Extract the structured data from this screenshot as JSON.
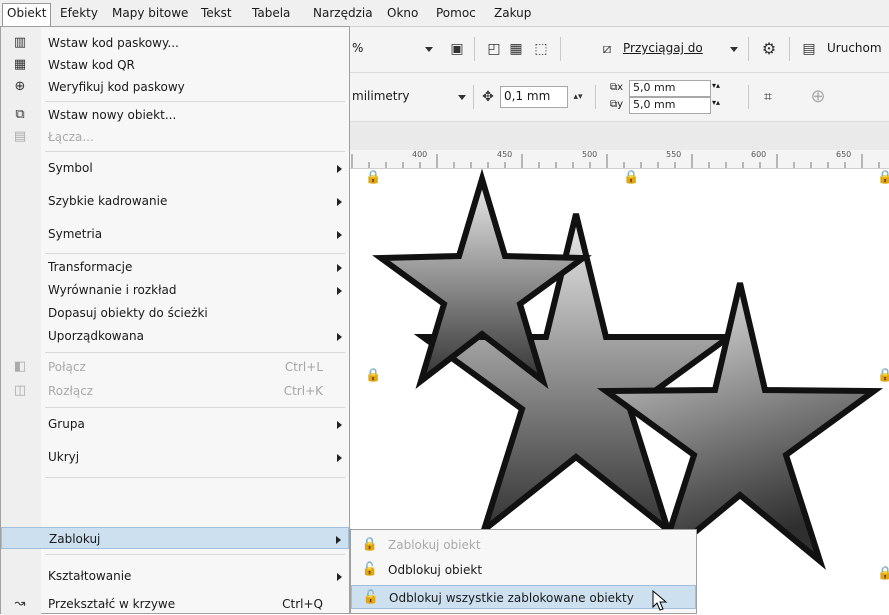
{
  "menubar": {
    "items": [
      "Obiekt",
      "Efekty",
      "Mapy bitowe",
      "Tekst",
      "Tabela",
      "Narzędzia",
      "Okno",
      "Pomoc",
      "Zakup"
    ]
  },
  "toolbar1": {
    "zoom_value": "%",
    "snap_label": "Przyciągaj do",
    "launch_label": "Uruchom"
  },
  "toolbar2": {
    "units_value": "milimetry",
    "nudge_value": "0,1 mm",
    "dup_x_value": "5,0 mm",
    "dup_y_value": "5,0 mm"
  },
  "ruler": {
    "labels": [
      "400",
      "450",
      "500",
      "550",
      "600",
      "650"
    ]
  },
  "menu": {
    "items": [
      {
        "label": "Wstaw kod paskowy...",
        "icon": "barcode-icon",
        "glyph": "▥"
      },
      {
        "label": "Wstaw kod QR",
        "icon": "qr-code-icon",
        "glyph": "▦"
      },
      {
        "label": "Weryfikuj kod paskowy",
        "icon": "verify-barcode-icon",
        "glyph": "⊕"
      },
      {
        "label": "Wstaw nowy obiekt...",
        "icon": "insert-object-icon",
        "glyph": "⧉"
      },
      {
        "label": "Łącza...",
        "icon": "ole-links-icon",
        "glyph": "▤",
        "disabled": true
      },
      {
        "label": "Symbol"
      },
      {
        "label": "Szybkie kadrowanie"
      },
      {
        "label": "Symetria"
      },
      {
        "label": "Transformacje"
      },
      {
        "label": "Wyrównanie i rozkład"
      },
      {
        "label": "Dopasuj obiekty do ścieżki"
      },
      {
        "label": "Uporządkowana"
      },
      {
        "label": "Połącz",
        "shortcut": "Ctrl+L",
        "icon": "combine-icon",
        "glyph": "◧",
        "disabled": true
      },
      {
        "label": "Rozłącz",
        "shortcut": "Ctrl+K",
        "icon": "break-apart-icon",
        "glyph": "◫",
        "disabled": true
      },
      {
        "label": "Grupa"
      },
      {
        "label": "Ukryj"
      },
      {
        "label": "Zablokuj"
      },
      {
        "label": "Kształtowanie"
      },
      {
        "label": "Przekształć w krzywe",
        "shortcut": "Ctrl+Q",
        "icon": "convert-to-curves-icon",
        "glyph": "↝"
      }
    ]
  },
  "submenu": {
    "items": [
      {
        "label": "Zablokuj obiekt",
        "icon": "lock-icon",
        "glyph": "🔒",
        "disabled": true
      },
      {
        "label": "Odblokuj obiekt",
        "icon": "unlock-icon",
        "glyph": "🔓"
      },
      {
        "label": "Odblokuj wszystkie zablokowane obiekty",
        "icon": "unlock-all-icon",
        "glyph": "🔓"
      }
    ]
  },
  "colors": {
    "highlight": "#cde0f0",
    "star_outline": "#111111",
    "star_light": "#e6e6e6",
    "star_dark": "#3a3a3a"
  }
}
